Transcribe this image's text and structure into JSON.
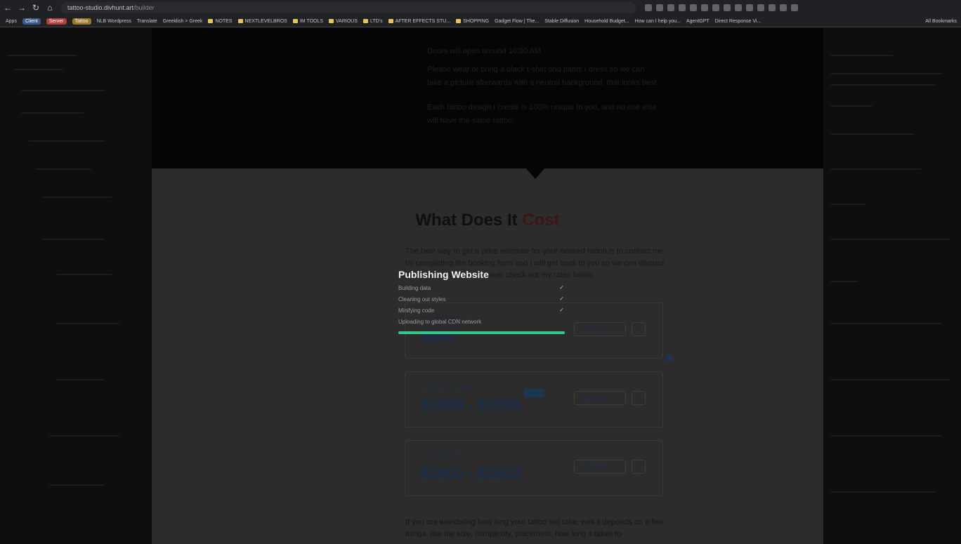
{
  "browser": {
    "url_host": "tattoo-studio.divhunt.art",
    "url_path": "/builder",
    "bookmarks": [
      {
        "label": "Apps",
        "kind": "apps"
      },
      {
        "label": "Client",
        "kind": "tag",
        "color": "#3b5a8a"
      },
      {
        "label": "Server",
        "kind": "tag",
        "color": "#b3403a"
      },
      {
        "label": "Tattoo",
        "kind": "tag",
        "color": "#9a7a2a"
      },
      {
        "label": "NLB Wordpress",
        "kind": "site"
      },
      {
        "label": "Translate",
        "kind": "site"
      },
      {
        "label": "Greeklish > Greek",
        "kind": "site"
      },
      {
        "label": "NOTES",
        "kind": "folder"
      },
      {
        "label": "NEXTLEVELBROS",
        "kind": "folder"
      },
      {
        "label": "IM TOOLS",
        "kind": "folder"
      },
      {
        "label": "VARIOUS",
        "kind": "folder"
      },
      {
        "label": "LTD's",
        "kind": "folder"
      },
      {
        "label": "AFTER EFFECTS STU...",
        "kind": "folder"
      },
      {
        "label": "SHOPPING",
        "kind": "folder"
      },
      {
        "label": "Gadget Flow | The...",
        "kind": "site"
      },
      {
        "label": "Stable Diffusion",
        "kind": "site"
      },
      {
        "label": "Household Budget...",
        "kind": "site"
      },
      {
        "label": "How can I help you...",
        "kind": "site"
      },
      {
        "label": "AgentGPT",
        "kind": "site"
      },
      {
        "label": "Direct Response Vi...",
        "kind": "site"
      }
    ],
    "all_bookmarks_label": "All Bookmarks"
  },
  "page": {
    "info_lines": [
      "Doors will open around 10:00 AM.",
      "Please wear or bring a black t-shirt and pants / dress so we can take a picture afterwards with a neutral background, that looks best.",
      "Each tattoo design I create is 100% unique to you, and no one else will have the same tattoo."
    ],
    "section_title_main": "What Does It ",
    "section_title_accent": "Cost",
    "intro_text": "The best way to get a price estimate for your desired tattoo is to contact me by completing the booking form and I will get back to you so we can discuss the details. You can however check out my rates below.",
    "cards": [
      {
        "label": "Hourly Rate",
        "price": "$500",
        "button": "Read More"
      },
      {
        "label": "Half-Day Rate",
        "price": "$1000 - $1250",
        "button": "Read More"
      },
      {
        "label": "Day Rate",
        "price": "$2000 - $2500",
        "button": "Read More"
      }
    ],
    "duration_text": "If you are wondering how long your tattoo will take, well it depends on a few things, like the size, complexity, placement, how long it takes to"
  },
  "publish_dialog": {
    "title": "Publishing Website",
    "steps": [
      {
        "label": "Building data",
        "done": true
      },
      {
        "label": "Cleaning out styles",
        "done": true
      },
      {
        "label": "Minifying code",
        "done": true
      },
      {
        "label": "Uploading to global CDN network",
        "done": false
      }
    ],
    "progress": 1.0,
    "progress_color": "#34c98a"
  }
}
